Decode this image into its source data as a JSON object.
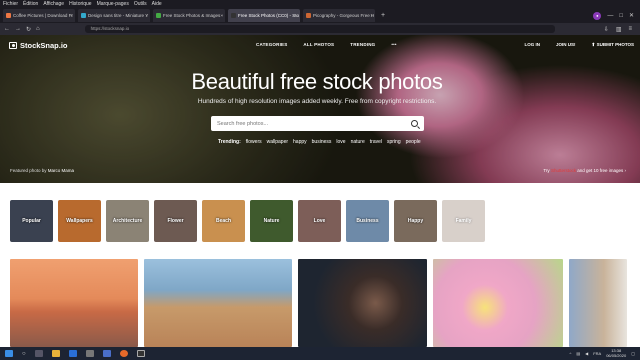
{
  "menu": [
    "Fichier",
    "Édition",
    "Affichage",
    "Historique",
    "Marque-pages",
    "Outils",
    "Aide"
  ],
  "tabs": [
    {
      "label": "Coffee Pictures | Download Fr",
      "active": false
    },
    {
      "label": "Design sans titre - Miniature Y",
      "active": false
    },
    {
      "label": "Free Stock Photos & Images -",
      "active": false
    },
    {
      "label": "Free Stock Photos (CC0) - Sto",
      "active": true
    },
    {
      "label": "Picography - Gorgeous Free H",
      "active": false
    }
  ],
  "url": "https://stocksnap.io",
  "site": {
    "logo": "StockSnap.io",
    "nav": [
      "CATEGORIES",
      "ALL PHOTOS",
      "TRENDING",
      "•••"
    ],
    "nav_right": [
      "LOG IN",
      "JOIN US!",
      "SUBMIT PHOTOS"
    ]
  },
  "hero": {
    "headline": "Beautiful free stock photos",
    "subline": "Hundreds of high resolution images added weekly. Free from copyright restrictions.",
    "search_placeholder": "Search free photos...",
    "trending_label": "Trending:",
    "trending": [
      "flowers",
      "wallpaper",
      "happy",
      "business",
      "love",
      "nature",
      "travel",
      "spring",
      "people"
    ],
    "credit_prefix": "Featured photo by",
    "credit_author": "Marco Mama",
    "promo_prefix": "Try",
    "promo_link": "Shutterstock",
    "promo_suffix": "and get 10 free images ›"
  },
  "categories": [
    {
      "label": "Popular",
      "color": "#3a4150"
    },
    {
      "label": "Wallpapers",
      "color": "#b86a2e"
    },
    {
      "label": "Architecture",
      "color": "#8b8375"
    },
    {
      "label": "Flower",
      "color": "#6d5a52"
    },
    {
      "label": "Beach",
      "color": "#c9904f"
    },
    {
      "label": "Nature",
      "color": "#3f5a2d"
    },
    {
      "label": "Love",
      "color": "#7d5e58"
    },
    {
      "label": "Business",
      "color": "#6e8aa8"
    },
    {
      "label": "Happy",
      "color": "#7a6a5c"
    },
    {
      "label": "Family",
      "color": "#b9aaa0"
    }
  ],
  "photos": [
    {
      "name": "sunset-beach-photo",
      "color": "#e48a5a"
    },
    {
      "name": "sand-path-photo",
      "color": "#7fa7c7"
    },
    {
      "name": "chocolate-photo",
      "color": "#1e2530"
    },
    {
      "name": "lily-photo",
      "color": "#e6a3c4"
    },
    {
      "name": "building-photo",
      "color": "#8fa8c8"
    }
  ],
  "taskbar": {
    "time": "13:38",
    "date": "06/05/2020",
    "lang": "FRA"
  }
}
